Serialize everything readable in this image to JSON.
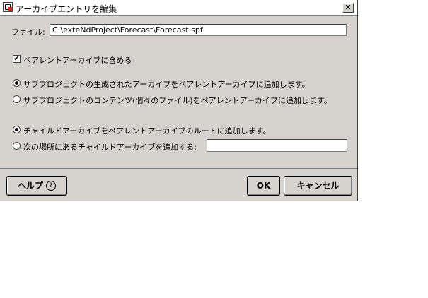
{
  "window": {
    "title": "アーカイブエントリを編集",
    "close_label": "✕"
  },
  "file": {
    "label": "ファイル:",
    "value": "C:\\exteNdProject\\Forecast\\Forecast.spf"
  },
  "include_parent": {
    "label": "ペアレントアーカイブに含める",
    "checked": true
  },
  "subproject_options": [
    {
      "label": "サブプロジェクトの生成されたアーカイブをペアレントアーカイブに追加します。",
      "selected": true
    },
    {
      "label": "サブプロジェクトのコンテンツ(個々のファイル)をペアレントアーカイブに追加します。",
      "selected": false
    }
  ],
  "child_options": [
    {
      "label": "チャイルドアーカイブをペアレントアーカイブのルートに追加します。",
      "selected": true
    },
    {
      "label": "次の場所にあるチャイルドアーカイブを追加する:",
      "selected": false,
      "value": ""
    }
  ],
  "buttons": {
    "help": "ヘルプ",
    "help_glyph": "?",
    "ok": "OK",
    "cancel": "キャンセル"
  }
}
